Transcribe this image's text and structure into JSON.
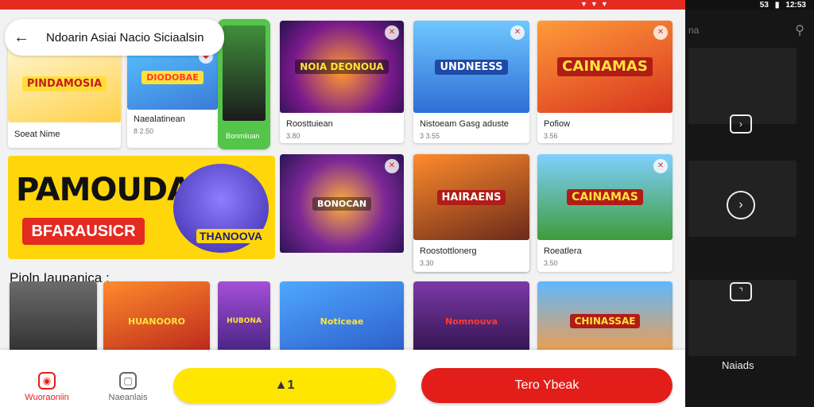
{
  "status_bar": {
    "time": "12:53",
    "signal": "53",
    "carets": "▼▼▼"
  },
  "search": {
    "query": "Ndoarin Asiai Nacio Siciaalsin"
  },
  "cards_row1": [
    {
      "title": "Soeat Nime",
      "sub": "",
      "logo": "PINDAMOSIA",
      "badge": ""
    },
    {
      "title": "Naealatinean",
      "sub": "8 2.50",
      "logo": "DIODOBAE",
      "badge": ""
    },
    {
      "title": "Bonmiiuan",
      "sub": "",
      "logo": "",
      "badge": ""
    },
    {
      "title": "Roosttuiean",
      "sub": "3.80",
      "logo": "NOIA DEONOUA",
      "badge": ""
    },
    {
      "title": "Nistoeam Gasg aduste",
      "sub": "3 3.55",
      "logo": "UNDNEESS",
      "badge": ""
    },
    {
      "title": "Pofiow",
      "sub": "3.56",
      "logo": "CAINAMAS",
      "badge": ""
    }
  ],
  "promo": {
    "line1": "PAMOUDAY",
    "line2": "BFARAUSICR",
    "hero_tag": "THANOOVA"
  },
  "cards_row2": [
    {
      "title": "Roostottlonerg",
      "sub": "3.30",
      "logo": "BONOCAN",
      "badge": ""
    },
    {
      "title": "Roeatlera",
      "sub": "3.50",
      "logo": "HAIRAENS",
      "badge": ""
    }
  ],
  "row3_art": [
    {
      "logo": ""
    },
    {
      "logo": "HUANOORO"
    },
    {
      "logo": "HUBONA"
    },
    {
      "logo": "Noticeae"
    },
    {
      "logo": "Nomnouva"
    },
    {
      "logo": "CHINASSAE"
    }
  ],
  "section_label": "Pioln Iaupanica :",
  "bottom_bar": {
    "nav_home_label": "Wuoraoniin",
    "nav_chat_label": "Naeanlais",
    "yellow_button_label": "▲1",
    "red_button_label": "Tero Ybeak"
  },
  "side_panel": {
    "label": "Naiads",
    "top_label": "na"
  },
  "colors": {
    "accent_red": "#e32b22",
    "accent_yellow": "#ffe600",
    "panel_dark": "#161616"
  }
}
